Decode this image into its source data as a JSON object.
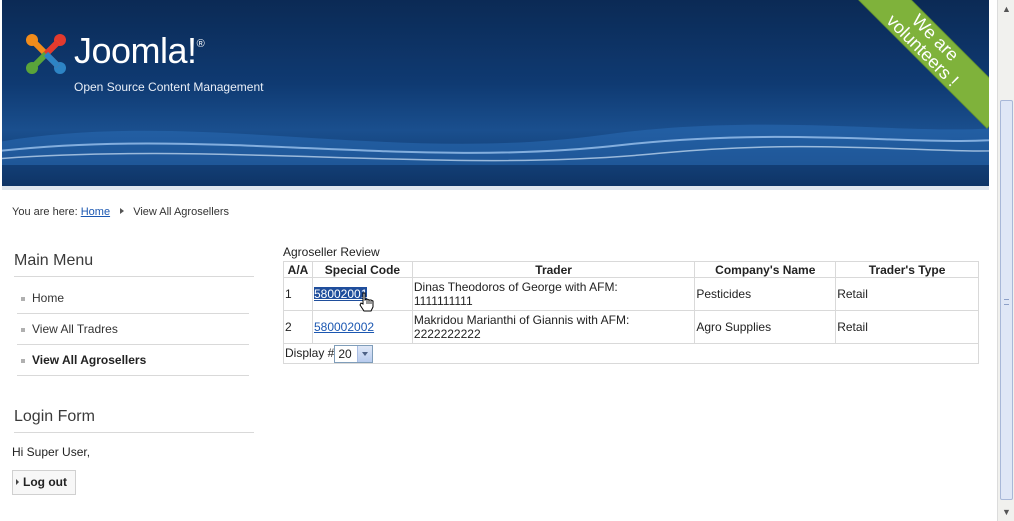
{
  "header": {
    "brand": "Joomla!",
    "trademark": "®",
    "tagline": "Open Source Content Management",
    "ribbon_line1": "We are",
    "ribbon_line2": "volunteers !"
  },
  "breadcrumb": {
    "prefix": "You are here:",
    "home": "Home",
    "current": "View All Agrosellers"
  },
  "main_menu": {
    "title": "Main Menu",
    "items": [
      {
        "label": "Home",
        "active": false
      },
      {
        "label": "View All Tradres",
        "active": false
      },
      {
        "label": "View All Agrosellers",
        "active": true
      }
    ]
  },
  "login": {
    "title": "Login Form",
    "greeting": "Hi Super User,",
    "logout_label": "Log out"
  },
  "review": {
    "title": "Agroseller Review",
    "columns": [
      "A/A",
      "Special Code",
      "Trader",
      "Company's Name",
      "Trader's Type"
    ],
    "rows": [
      {
        "aa": "1",
        "code": "58002001",
        "trader_line1": "Dinas Theodoros of George with AFM:",
        "trader_line2": "1111111111",
        "company": "Pesticides",
        "type": "Retail"
      },
      {
        "aa": "2",
        "code": "580002002",
        "trader_line1": "Makridou Marianthi of Giannis with AFM:",
        "trader_line2": "2222222222",
        "company": "Agro Supplies",
        "type": "Retail"
      }
    ],
    "display_label": "Display #",
    "display_value": "20"
  },
  "colors": {
    "header_bg": "#0f3a72",
    "ribbon": "#7fb23b",
    "link": "#1b57b1"
  }
}
